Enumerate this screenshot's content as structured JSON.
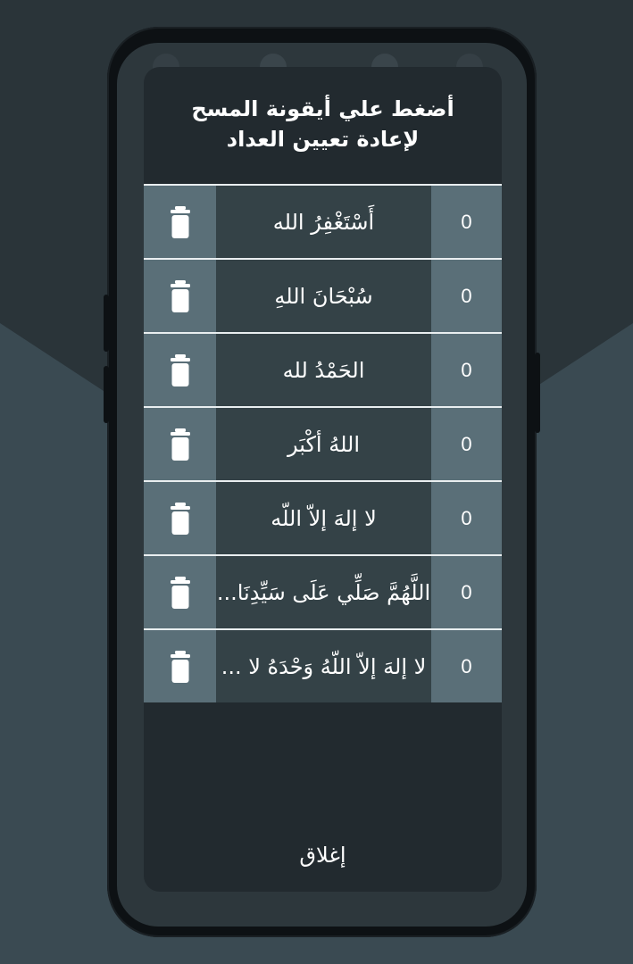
{
  "dialog": {
    "title": "أضغط علي أيقونة المسح لإعادة تعيين العداد",
    "close_label": "إغلاق"
  },
  "counters": [
    {
      "text": "أَسْتَغْفِرُ الله",
      "count": "0",
      "delete_icon": "trash-icon"
    },
    {
      "text": "سُبْحَانَ اللهِ",
      "count": "0",
      "delete_icon": "trash-icon"
    },
    {
      "text": "الحَمْدُ لله",
      "count": "0",
      "delete_icon": "trash-icon"
    },
    {
      "text": "اللهُ أكْبَر",
      "count": "0",
      "delete_icon": "trash-icon"
    },
    {
      "text": "لا إلهَ إلاّ اللّه",
      "count": "0",
      "delete_icon": "trash-icon"
    },
    {
      "text": "اللَّهُمَّ صَلِّي عَلَى سَيِّدِنَا...",
      "count": "0",
      "delete_icon": "trash-icon"
    },
    {
      "text": "لا إلهَ إلاّ اللّهُ وَحْدَهُ لا ...",
      "count": "0",
      "delete_icon": "trash-icon"
    }
  ],
  "colors": {
    "background_dark": "#2a3439",
    "background_light": "#3a4a52",
    "dialog": "#222a2f",
    "row_text_bg": "#344247",
    "row_side_bg": "#5a6f78",
    "text": "#ffffff"
  }
}
